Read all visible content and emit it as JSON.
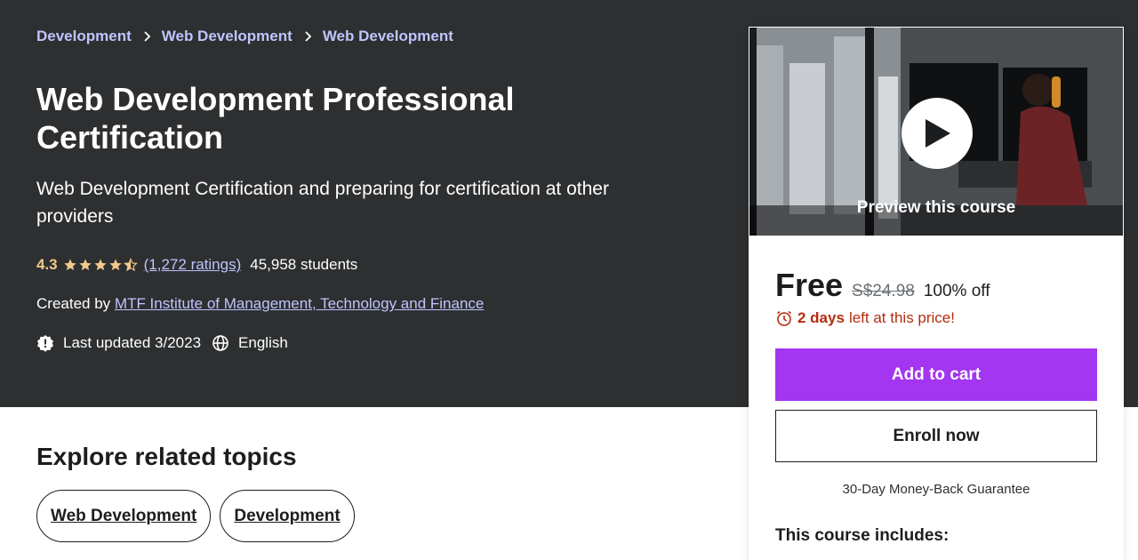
{
  "breadcrumb": {
    "items": [
      "Development",
      "Web Development",
      "Web Development"
    ]
  },
  "course": {
    "title": "Web Development Professional Certification",
    "subtitle": "Web Development Certification and preparing for certification at other providers",
    "rating": "4.3",
    "rating_value": 4.3,
    "ratings_count": "(1,272 ratings)",
    "students": "45,958 students",
    "created_by_label": "Created by",
    "author": "MTF Institute of Management, Technology and Finance",
    "last_updated": "Last updated 3/2023",
    "language": "English"
  },
  "sidebar": {
    "preview_label": "Preview this course",
    "price": "Free",
    "original_price": "S$24.98",
    "discount": "100% off",
    "timer_bold": "2 days",
    "timer_rest": "left at this price!",
    "add_to_cart": "Add to cart",
    "enroll_now": "Enroll now",
    "guarantee": "30-Day Money-Back Guarantee",
    "includes_title": "This course includes:"
  },
  "related": {
    "title": "Explore related topics",
    "chips": [
      "Web Development",
      "Development"
    ]
  },
  "colors": {
    "hero_bg": "#2d2f31",
    "link_purple": "#c0c4fc",
    "star_gold": "#f3ca8c",
    "cta_purple": "#a435f0",
    "timer_red": "#b32d0f"
  },
  "icons": {
    "breadcrumb_sep": "chevron-right-icon",
    "star": "star-icon",
    "updated": "alert-badge-icon",
    "language": "globe-icon",
    "play": "play-icon",
    "timer": "alarm-clock-icon"
  }
}
